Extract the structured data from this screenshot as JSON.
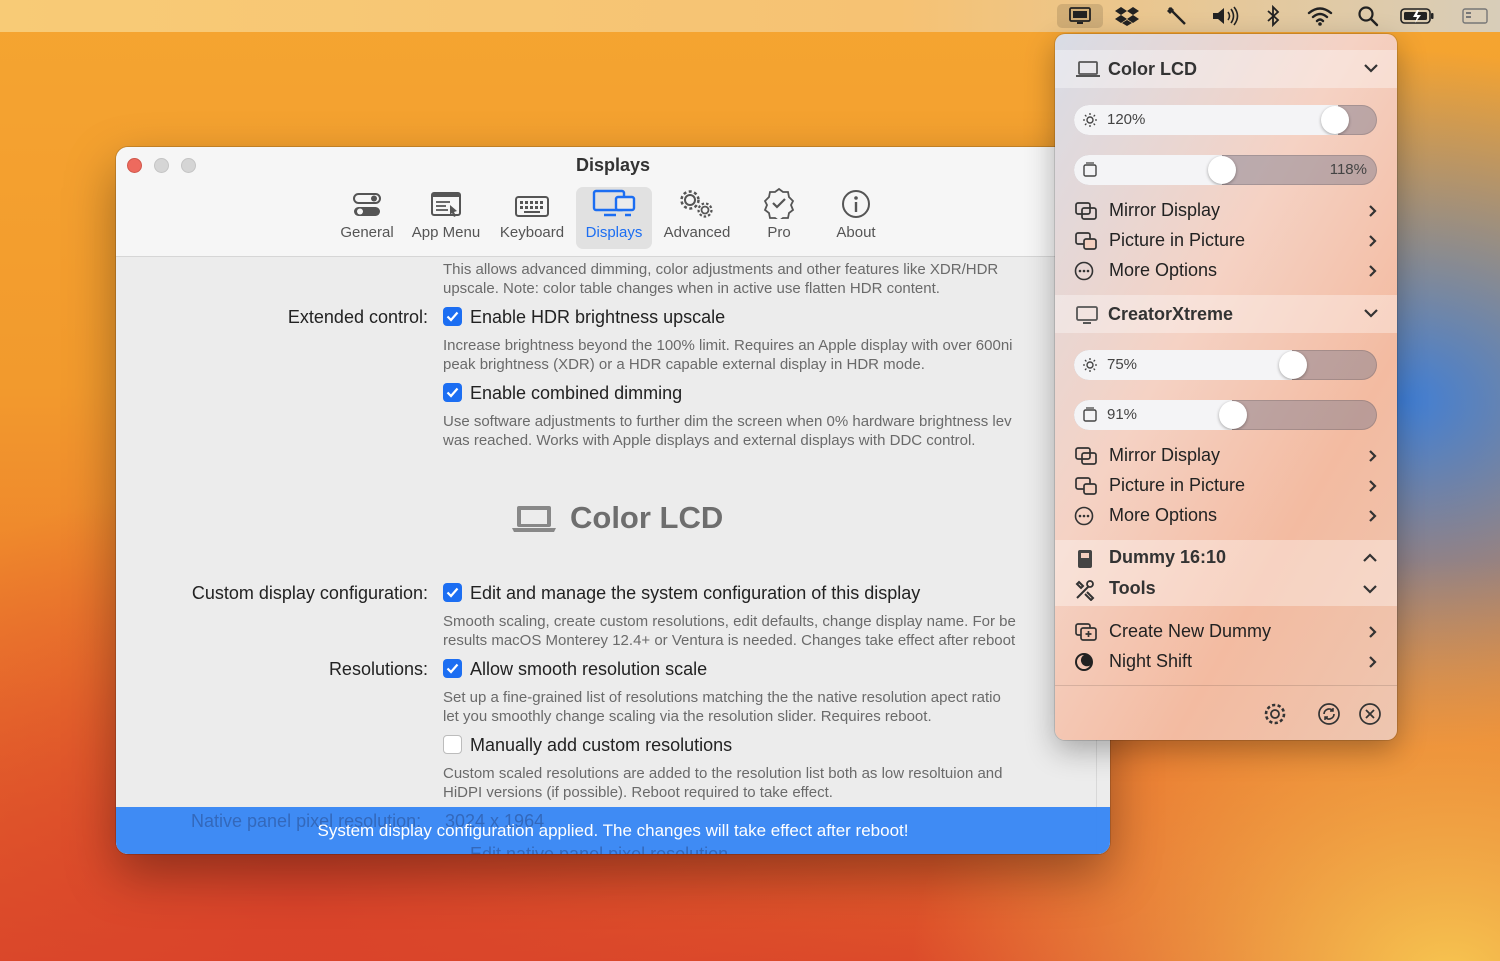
{
  "menubar": {
    "icons": [
      "display-icon",
      "dropbox-icon",
      "pen-icon",
      "volume-icon",
      "bluetooth-icon",
      "wifi-icon",
      "search-icon",
      "battery-icon",
      "control-center-icon"
    ]
  },
  "window": {
    "title": "Displays",
    "tabs": [
      {
        "label": "General",
        "icon": "general-icon"
      },
      {
        "label": "App Menu",
        "icon": "app-menu-icon"
      },
      {
        "label": "Keyboard",
        "icon": "keyboard-icon"
      },
      {
        "label": "Displays",
        "icon": "displays-icon",
        "active": true
      },
      {
        "label": "Advanced",
        "icon": "gears-icon"
      },
      {
        "label": "Pro",
        "icon": "badge-icon"
      },
      {
        "label": "About",
        "icon": "info-icon"
      }
    ],
    "top_desc_1": "This allows advanced dimming, color adjustments and other features like XDR/HDR",
    "top_desc_2": "upscale. Note: color table changes when in active use flatten HDR content.",
    "extended_label": "Extended control:",
    "hdr_label": "Enable HDR brightness upscale",
    "hdr_checked": true,
    "hdr_desc_1": "Increase brightness beyond the 100% limit. Requires an Apple display with over 600ni",
    "hdr_desc_2": "peak brightness (XDR) or a HDR capable external display in HDR mode.",
    "combined_label": "Enable combined dimming",
    "combined_checked": true,
    "combined_desc_1": "Use software adjustments to further dim the screen when 0% hardware brightness lev",
    "combined_desc_2": "was reached. Works with Apple displays and external displays with DDC control.",
    "section_title": "Color LCD",
    "custom_config_label": "Custom display configuration:",
    "custom_config_check": "Edit and manage the system configuration of this display",
    "custom_config_checked": true,
    "custom_desc_1": "Smooth scaling, create custom resolutions, edit defaults, change display name. For be",
    "custom_desc_2": "results macOS Monterey 12.4+ or Ventura is needed. Changes take effect after reboot",
    "resolutions_label": "Resolutions:",
    "smooth_label": "Allow smooth resolution scale",
    "smooth_checked": true,
    "smooth_desc_1": "Set up a fine-grained list of resolutions matching the the native resolution apect ratio",
    "smooth_desc_2": "let you smoothly change scaling via the resolution slider. Requires reboot.",
    "manual_label": "Manually add custom resolutions",
    "manual_checked": false,
    "manual_desc_1": "Custom scaled resolutions are added to the resolution list both as low resoltuion and",
    "manual_desc_2": "HiDPI versions (if possible). Reboot required to take effect.",
    "native_label": "Native panel pixel resolution:",
    "native_value": "3024 x 1964",
    "edit_native_label": "Edit native panel pixel resolution",
    "banner": "System display configuration applied. The changes will take effect after reboot!"
  },
  "panel": {
    "display1": {
      "name": "Color LCD",
      "brightness_label": "120%",
      "brightness": 0.87,
      "contrast_label": "118%",
      "contrast": 0.49,
      "items": [
        "Mirror Display",
        "Picture in Picture",
        "More Options"
      ]
    },
    "display2": {
      "name": "CreatorXtreme",
      "brightness_label": "75%",
      "brightness": 0.72,
      "contrast_label": "91%",
      "contrast": 0.52,
      "items": [
        "Mirror Display",
        "Picture in Picture",
        "More Options"
      ]
    },
    "dummy_label": "Dummy 16:10",
    "tools_label": "Tools",
    "create_dummy": "Create New Dummy",
    "night_shift": "Night Shift"
  }
}
